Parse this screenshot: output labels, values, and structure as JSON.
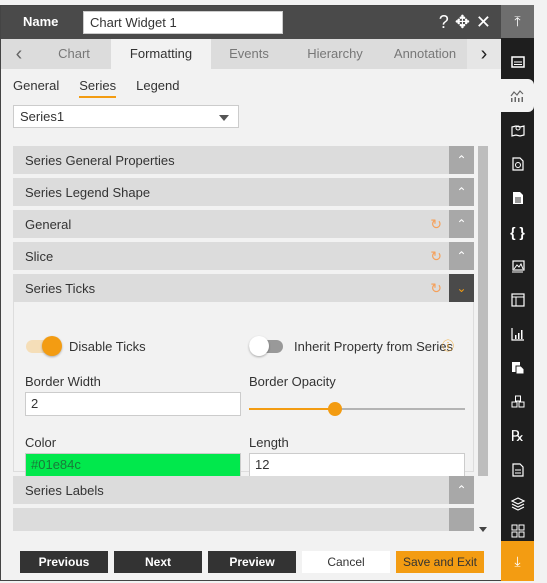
{
  "header": {
    "name_label": "Name",
    "name_value": "Chart Widget 1",
    "help_icon": "?",
    "move_icon": "✥",
    "close_icon": "✕"
  },
  "tabs": {
    "items": [
      {
        "label": "Chart",
        "active": false
      },
      {
        "label": "Formatting",
        "active": true
      },
      {
        "label": "Events",
        "active": false
      },
      {
        "label": "Hierarchy",
        "active": false
      },
      {
        "label": "Annotation",
        "active": false
      }
    ]
  },
  "subtabs": {
    "items": [
      {
        "label": "General",
        "active": false
      },
      {
        "label": "Series",
        "active": true
      },
      {
        "label": "Legend",
        "active": false
      }
    ]
  },
  "series_select": {
    "value": "Series1"
  },
  "accordions": [
    {
      "title": "Series General Properties",
      "reset": false,
      "open": false
    },
    {
      "title": "Series Legend Shape",
      "reset": false,
      "open": false
    },
    {
      "title": "General",
      "reset": true,
      "open": false
    },
    {
      "title": "Slice",
      "reset": true,
      "open": false
    },
    {
      "title": "Series Ticks",
      "reset": true,
      "open": true
    },
    {
      "title": "Series Labels",
      "reset": false,
      "open": false
    }
  ],
  "series_ticks": {
    "disable_ticks": {
      "label": "Disable Ticks",
      "on": true
    },
    "inherit": {
      "label": "Inherit Property from Series",
      "on": false
    },
    "border_width": {
      "label": "Border Width",
      "value": "2"
    },
    "border_opacity": {
      "label": "Border Opacity",
      "value": 0.4
    },
    "color": {
      "label": "Color",
      "value": "#01e84c"
    },
    "length": {
      "label": "Length",
      "value": "12"
    }
  },
  "footer": {
    "previous": "Previous",
    "next": "Next",
    "preview": "Preview",
    "cancel": "Cancel",
    "save_exit": "Save and Exit"
  },
  "colors": {
    "accent": "#f39c12",
    "header_bg": "#4a4a4a",
    "rail_bg": "#1e1e1e",
    "tick_color": "#01e84c"
  },
  "right_rail": {
    "items": [
      "scroll-top-icon",
      "widget-icon",
      "chart-icon",
      "map-icon",
      "report-icon",
      "document-icon",
      "code-braces-icon",
      "image-icon",
      "table-icon",
      "bar-chart-icon",
      "copy-icon",
      "cubes-icon",
      "rx-icon",
      "form-icon",
      "layers-icon",
      "grid-icon",
      "scroll-bottom-icon"
    ]
  }
}
